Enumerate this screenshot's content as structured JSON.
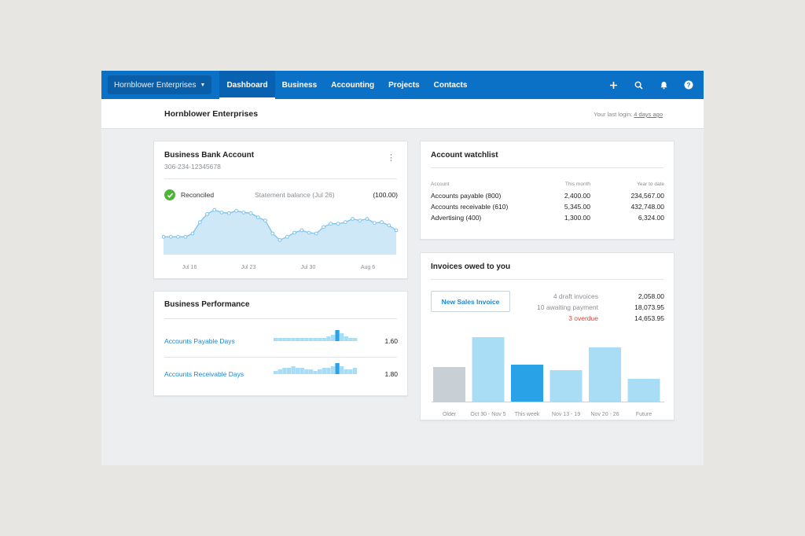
{
  "nav": {
    "org_switcher": "Hornblower Enterprises",
    "tabs": [
      "Dashboard",
      "Business",
      "Accounting",
      "Projects",
      "Contacts"
    ],
    "active_tab": "Dashboard",
    "icons": [
      "plus-icon",
      "search-icon",
      "bell-icon",
      "help-icon"
    ]
  },
  "header": {
    "org_name": "Hornblower Enterprises",
    "last_login_prefix": "Your last login: ",
    "last_login_link": "4 days ago"
  },
  "bank": {
    "title": "Business Bank Account",
    "account_number": "306-234-12345678",
    "reconciled_label": "Reconciled",
    "statement_label": "Statement balance (Jul 26)",
    "statement_value": "(100.00)",
    "x_labels": [
      "Jul 16",
      "Jul 23",
      "Jul 30",
      "Aug 6"
    ]
  },
  "performance": {
    "title": "Business Performance",
    "rows": [
      {
        "label": "Accounts Payable Days",
        "value": "1.60"
      },
      {
        "label": "Accounts Receivable Days",
        "value": "1.80"
      }
    ]
  },
  "watchlist": {
    "title": "Account watchlist",
    "headers": [
      "Account",
      "This month",
      "Year to date"
    ],
    "rows": [
      {
        "account": "Accounts payable (800)",
        "month": "2,400.00",
        "ytd": "234,567.00"
      },
      {
        "account": "Accounts receivable (610)",
        "month": "5,345.00",
        "ytd": "432,748.00"
      },
      {
        "account": "Advertising (400)",
        "month": "1,300.00",
        "ytd": "6,324.00"
      }
    ]
  },
  "invoices": {
    "title": "Invoices owed to you",
    "new_button": "New Sales Invoice",
    "summary": [
      {
        "label": "4 draft invoices",
        "value": "2,058.00",
        "color": "#8a8f94"
      },
      {
        "label": "10 awaiting payment",
        "value": "18,073.95",
        "color": "#8a8f94"
      },
      {
        "label": "3 overdue",
        "value": "14,653.95",
        "color": "#e0423b"
      }
    ]
  },
  "colors": {
    "nav_blue": "#0a71c6",
    "link_blue": "#1a87d6",
    "reconciled_green": "#51b43a",
    "chart_line": "#7dc3ec",
    "chart_fill": "#cfe8f7",
    "bar_light": "#a9dcf5",
    "bar_dark": "#2aa2e8",
    "bar_grey": "#c8d0d6",
    "overdue_red": "#e0423b"
  },
  "chart_data": [
    {
      "type": "area",
      "x_tick_labels": [
        "Jul 16",
        "Jul 23",
        "Jul 30",
        "Aug 6"
      ],
      "series": [
        {
          "values": [
            62,
            62,
            62,
            62,
            66,
            80,
            90,
            95,
            92,
            91,
            94,
            92,
            91,
            86,
            82,
            66,
            58,
            62,
            67,
            70,
            67,
            66,
            74,
            78,
            78,
            80,
            84,
            82,
            84,
            79,
            80,
            76,
            70
          ]
        }
      ]
    },
    {
      "type": "bar",
      "categories": [
        "Older",
        "Oct 30 - Nov 5",
        "This week",
        "Nov 13 - 19",
        "Nov 20 - 26",
        "Future"
      ],
      "values": [
        44,
        82,
        47,
        40,
        69,
        29
      ],
      "bar_colors": [
        "#c8d0d6",
        "#a9dcf5",
        "#2aa2e8",
        "#a9dcf5",
        "#a9dcf5",
        "#a9dcf5"
      ]
    },
    {
      "type": "bar",
      "label": "Accounts Payable Days",
      "values": [
        2,
        2,
        2,
        2,
        2,
        2,
        2,
        2,
        2,
        2,
        2,
        2,
        3,
        4,
        7,
        5,
        3,
        2,
        2
      ],
      "highlight_index": 14
    },
    {
      "type": "bar",
      "label": "Accounts Receivable Days",
      "values": [
        2,
        3,
        4,
        4,
        5,
        4,
        4,
        3,
        3,
        2,
        3,
        4,
        4,
        5,
        7,
        5,
        3,
        3,
        4
      ],
      "highlight_index": 14
    }
  ]
}
